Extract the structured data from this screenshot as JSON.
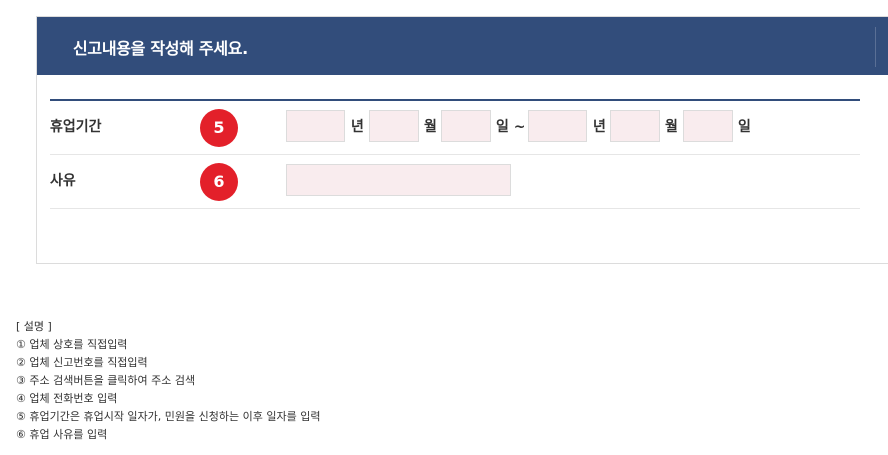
{
  "header": {
    "title": "신고내용을 작성해 주세요."
  },
  "period": {
    "label": "휴업기간",
    "badge": "5",
    "units": {
      "year": "년",
      "month": "월",
      "day_tilde": "일 ~",
      "day": "일"
    },
    "start": {
      "year": "",
      "month": "",
      "day": ""
    },
    "end": {
      "year": "",
      "month": "",
      "day": ""
    }
  },
  "reason": {
    "label": "사유",
    "badge": "6",
    "value": ""
  },
  "description": {
    "heading": "[ 설명 ]",
    "items": [
      "① 업체 상호를 직접입력",
      "② 업체 신고번호를 직접입력",
      "③ 주소 검색버튼을 클릭하여 주소 검색",
      "④ 업체 전화번호 입력",
      "⑤ 휴업기간은 휴업시작 일자가, 민원을 신청하는 이후 일자를 입력",
      "⑥ 휴업 사유를 입력"
    ]
  }
}
